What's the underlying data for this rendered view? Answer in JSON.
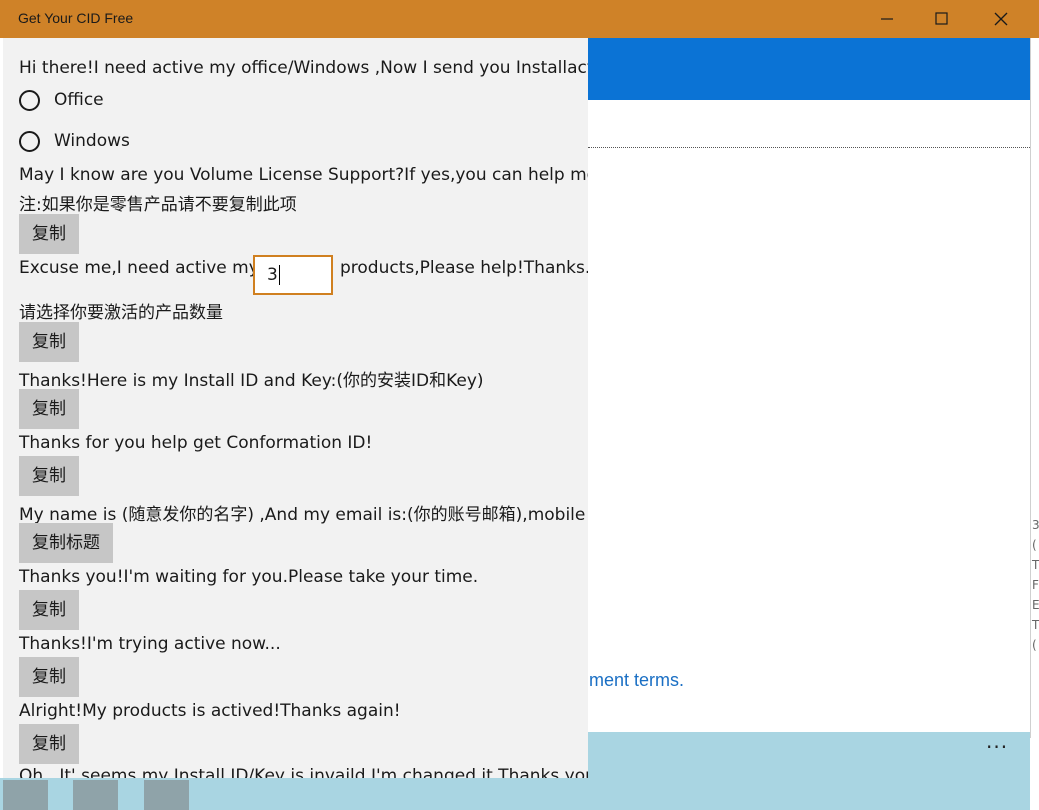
{
  "window": {
    "title": "Get Your CID Free"
  },
  "controls": {
    "minimize": "minimize",
    "maximize": "maximize",
    "close": "close"
  },
  "form": {
    "greeting": "Hi there!I need active my office/Windows ,Now I send you Installaction",
    "options": [
      "Office",
      "Windows"
    ],
    "volume_question": "May I know are you Volume License Support?If yes,you can help me",
    "retail_note": "注:如果你是零售产品请不要复制此项",
    "copy_label": "复制",
    "quantity_prefix": "Excuse me,I need active my",
    "quantity_value": "3",
    "quantity_suffix": "products,Please help!Thanks.",
    "quantity_hint": "请选择你要激活的产品数量",
    "install_id_line": "Thanks!Here is my Install ID and Key:(你的安装ID和Key)",
    "conf_line": "Thanks for you help get Conformation ID!",
    "name_line": "My name is (随意发你的名字) ,And my email is:(你的账号邮箱),mobile",
    "copy_title_label": "复制标题",
    "waiting_line": "Thanks you!I'm waiting for you.Please take your time.",
    "trying_line": "Thanks!I'm trying active now...",
    "activated_line": "Alright!My products is actived!Thanks again!",
    "invalid_line": "Oh...It' seems my Install ID/Key is invaild.I'm changed it.Thanks you"
  },
  "background": {
    "agreement_link": "ment terms.",
    "more_icon": "···",
    "edge_chars": [
      "3",
      "(",
      "T",
      "F",
      "E",
      "T",
      "("
    ]
  },
  "colors": {
    "titlebar": "#cf8228",
    "panel": "#f2f2f2",
    "button": "#c6c6c6",
    "accent_border": "#d08020",
    "blue": "#0b73d5",
    "light_blue": "#a9d5e2"
  }
}
